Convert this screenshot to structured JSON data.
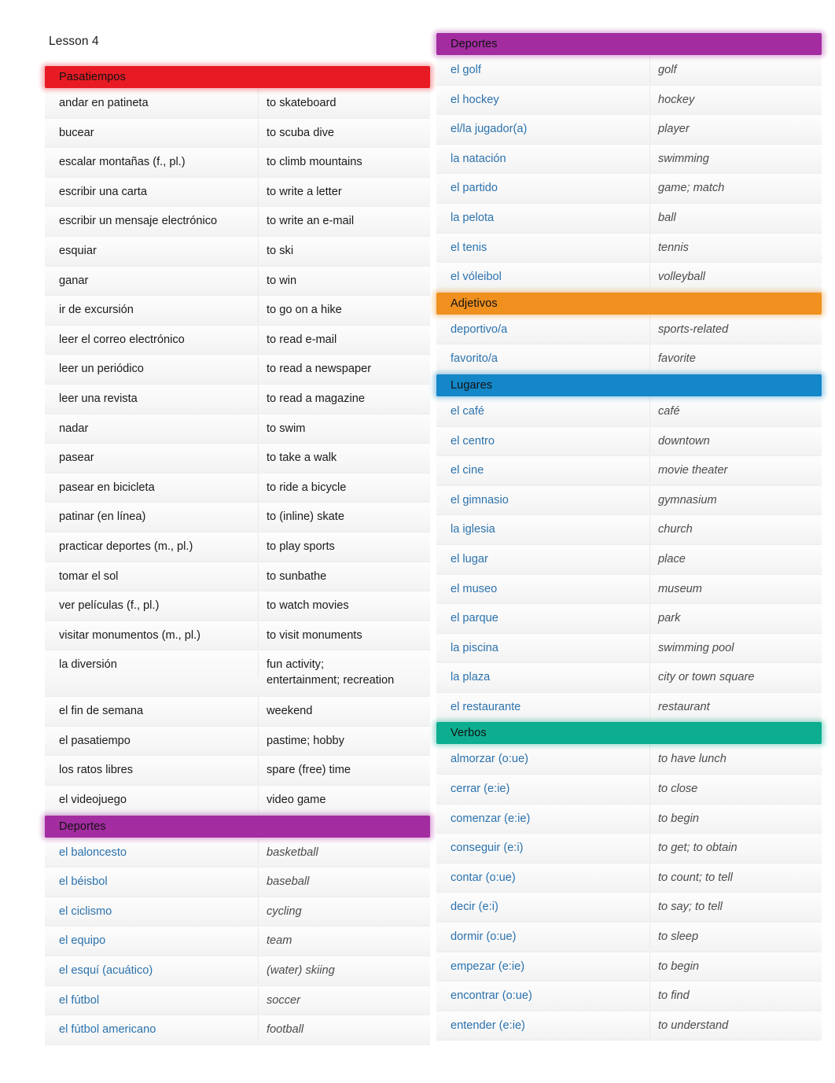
{
  "document": {
    "title": "Lesson 4",
    "type": "vocabulary-list",
    "language_pair": "Spanish-English"
  },
  "colors": {
    "pasatiempos": "#e81b24",
    "deportes": "#a32ca0",
    "adjetivos": "#f0901f",
    "lugares": "#1487c9",
    "verbos": "#0dae90",
    "spanish_text_blue": "#2b72ad",
    "english_text_gray": "#4b4b4b",
    "plain_text": "#1a1a1a"
  },
  "left_column": {
    "sections": [
      {
        "header": "Pasatiempos",
        "color_key": "pasatiempos",
        "style": "plain",
        "entries": [
          {
            "es": "andar en patineta",
            "en": "to skateboard"
          },
          {
            "es": "bucear",
            "en": "to scuba dive"
          },
          {
            "es": "escalar montañas (f., pl.)",
            "en": "to climb mountains"
          },
          {
            "es": "escribir una carta",
            "en": "to write a letter"
          },
          {
            "es": "escribir un mensaje electrónico",
            "en": "to write an e-mail"
          },
          {
            "es": "esquiar",
            "en": "to ski"
          },
          {
            "es": "ganar",
            "en": "to win"
          },
          {
            "es": "ir de excursión",
            "en": "to go on a hike"
          },
          {
            "es": "leer el correo electrónico",
            "en": "to read e-mail"
          },
          {
            "es": "leer un periódico",
            "en": "to read a newspaper"
          },
          {
            "es": "leer una revista",
            "en": "to read a magazine"
          },
          {
            "es": "nadar",
            "en": "to swim"
          },
          {
            "es": "pasear",
            "en": "to take a walk"
          },
          {
            "es": "pasear en bicicleta",
            "en": "to ride a bicycle"
          },
          {
            "es": "patinar (en línea)",
            "en": "to (inline) skate"
          },
          {
            "es": "practicar deportes (m., pl.)",
            "en": "to play sports"
          },
          {
            "es": "tomar el sol",
            "en": "to sunbathe"
          },
          {
            "es": "ver películas (f., pl.)",
            "en": "to watch movies"
          },
          {
            "es": "visitar monumentos (m., pl.)",
            "en": "to visit monuments"
          },
          {
            "es": "la diversión",
            "en": "fun activity;\nentertainment; recreation",
            "tall": true
          },
          {
            "es": "el fin de semana",
            "en": "weekend"
          },
          {
            "es": "el pasatiempo",
            "en": "pastime; hobby"
          },
          {
            "es": "los ratos libres",
            "en": "spare (free) time"
          },
          {
            "es": "el videojuego",
            "en": "video game"
          }
        ]
      },
      {
        "header": "Deportes",
        "color_key": "deportes",
        "style": "alt",
        "entries": [
          {
            "es": "el baloncesto",
            "en": "basketball"
          },
          {
            "es": "el béisbol",
            "en": "baseball"
          },
          {
            "es": "el ciclismo",
            "en": "cycling"
          },
          {
            "es": "el equipo",
            "en": "team"
          },
          {
            "es": "el esquí (acuático)",
            "en": "(water) skiing"
          },
          {
            "es": "el fútbol",
            "en": "soccer"
          },
          {
            "es": "el fútbol americano",
            "en": "football"
          }
        ]
      }
    ]
  },
  "right_column": {
    "sections": [
      {
        "header": "Deportes",
        "color_key": "deportes",
        "style": "alt",
        "entries": [
          {
            "es": "el golf",
            "en": "golf"
          },
          {
            "es": "el hockey",
            "en": "hockey"
          },
          {
            "es": "el/la jugador(a)",
            "en": "player"
          },
          {
            "es": "la natación",
            "en": "swimming"
          },
          {
            "es": "el partido",
            "en": "game; match"
          },
          {
            "es": "la pelota",
            "en": "ball"
          },
          {
            "es": "el tenis",
            "en": "tennis"
          },
          {
            "es": "el vóleibol",
            "en": "volleyball"
          }
        ]
      },
      {
        "header": "Adjetivos",
        "color_key": "adjetivos",
        "style": "alt",
        "entries": [
          {
            "es": "deportivo/a",
            "en": "sports-related"
          },
          {
            "es": "favorito/a",
            "en": "favorite"
          }
        ]
      },
      {
        "header": "Lugares",
        "color_key": "lugares",
        "style": "alt",
        "entries": [
          {
            "es": "el café",
            "en": "café"
          },
          {
            "es": "el centro",
            "en": "downtown"
          },
          {
            "es": "el cine",
            "en": "movie theater"
          },
          {
            "es": "el gimnasio",
            "en": "gymnasium"
          },
          {
            "es": "la iglesia",
            "en": "church"
          },
          {
            "es": "el lugar",
            "en": "place"
          },
          {
            "es": "el museo",
            "en": "museum"
          },
          {
            "es": "el parque",
            "en": "park"
          },
          {
            "es": "la piscina",
            "en": "swimming pool"
          },
          {
            "es": "la plaza",
            "en": "city or town square"
          },
          {
            "es": "el restaurante",
            "en": "restaurant"
          }
        ]
      },
      {
        "header": "Verbos",
        "color_key": "verbos",
        "style": "alt",
        "entries": [
          {
            "es": "almorzar (o:ue)",
            "en": "to have lunch"
          },
          {
            "es": "cerrar (e:ie)",
            "en": "to close"
          },
          {
            "es": "comenzar (e:ie)",
            "en": "to begin"
          },
          {
            "es": "conseguir (e:i)",
            "en": "to get; to obtain"
          },
          {
            "es": "contar (o:ue)",
            "en": "to count; to tell"
          },
          {
            "es": "decir (e:i)",
            "en": "to say; to tell"
          },
          {
            "es": "dormir (o:ue)",
            "en": "to sleep"
          },
          {
            "es": "empezar (e:ie)",
            "en": "to begin"
          },
          {
            "es": "encontrar (o:ue)",
            "en": "to find"
          },
          {
            "es": "entender (e:ie)",
            "en": "to understand"
          }
        ]
      }
    ]
  }
}
